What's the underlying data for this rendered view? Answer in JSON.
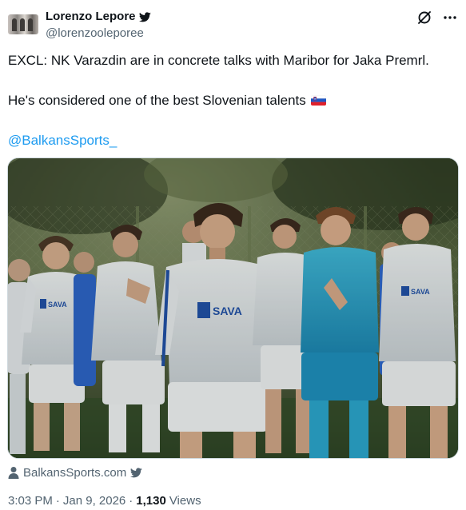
{
  "author": {
    "display_name": "Lorenzo Lepore",
    "handle": "@lorenzooleporee",
    "verified_icon": "twitter-bird-icon"
  },
  "header_actions": {
    "grok_icon": "grok-icon",
    "more_icon": "more-icon"
  },
  "tweet": {
    "line1": "EXCL: NK Varazdin are in concrete talks with Maribor for Jaka Premrl.",
    "line2": "He's considered one of the best Slovenian talents",
    "flag_icon": "slovenia-flag-icon",
    "mention": "@BalkansSports_"
  },
  "media": {
    "kind": "photo",
    "jersey_sponsor": "SAVA"
  },
  "source": {
    "name": "BalkansSports.com",
    "person_icon": "person-icon",
    "bird_icon": "twitter-bird-icon"
  },
  "meta": {
    "time": "3:03 PM",
    "separator": "·",
    "date": "Jan 9, 2026",
    "views_count": "1,130",
    "views_label": "Views"
  },
  "colors": {
    "link": "#1d9bf0",
    "secondary_text": "#536471",
    "primary_text": "#0f1419",
    "border": "#cfd9de"
  }
}
